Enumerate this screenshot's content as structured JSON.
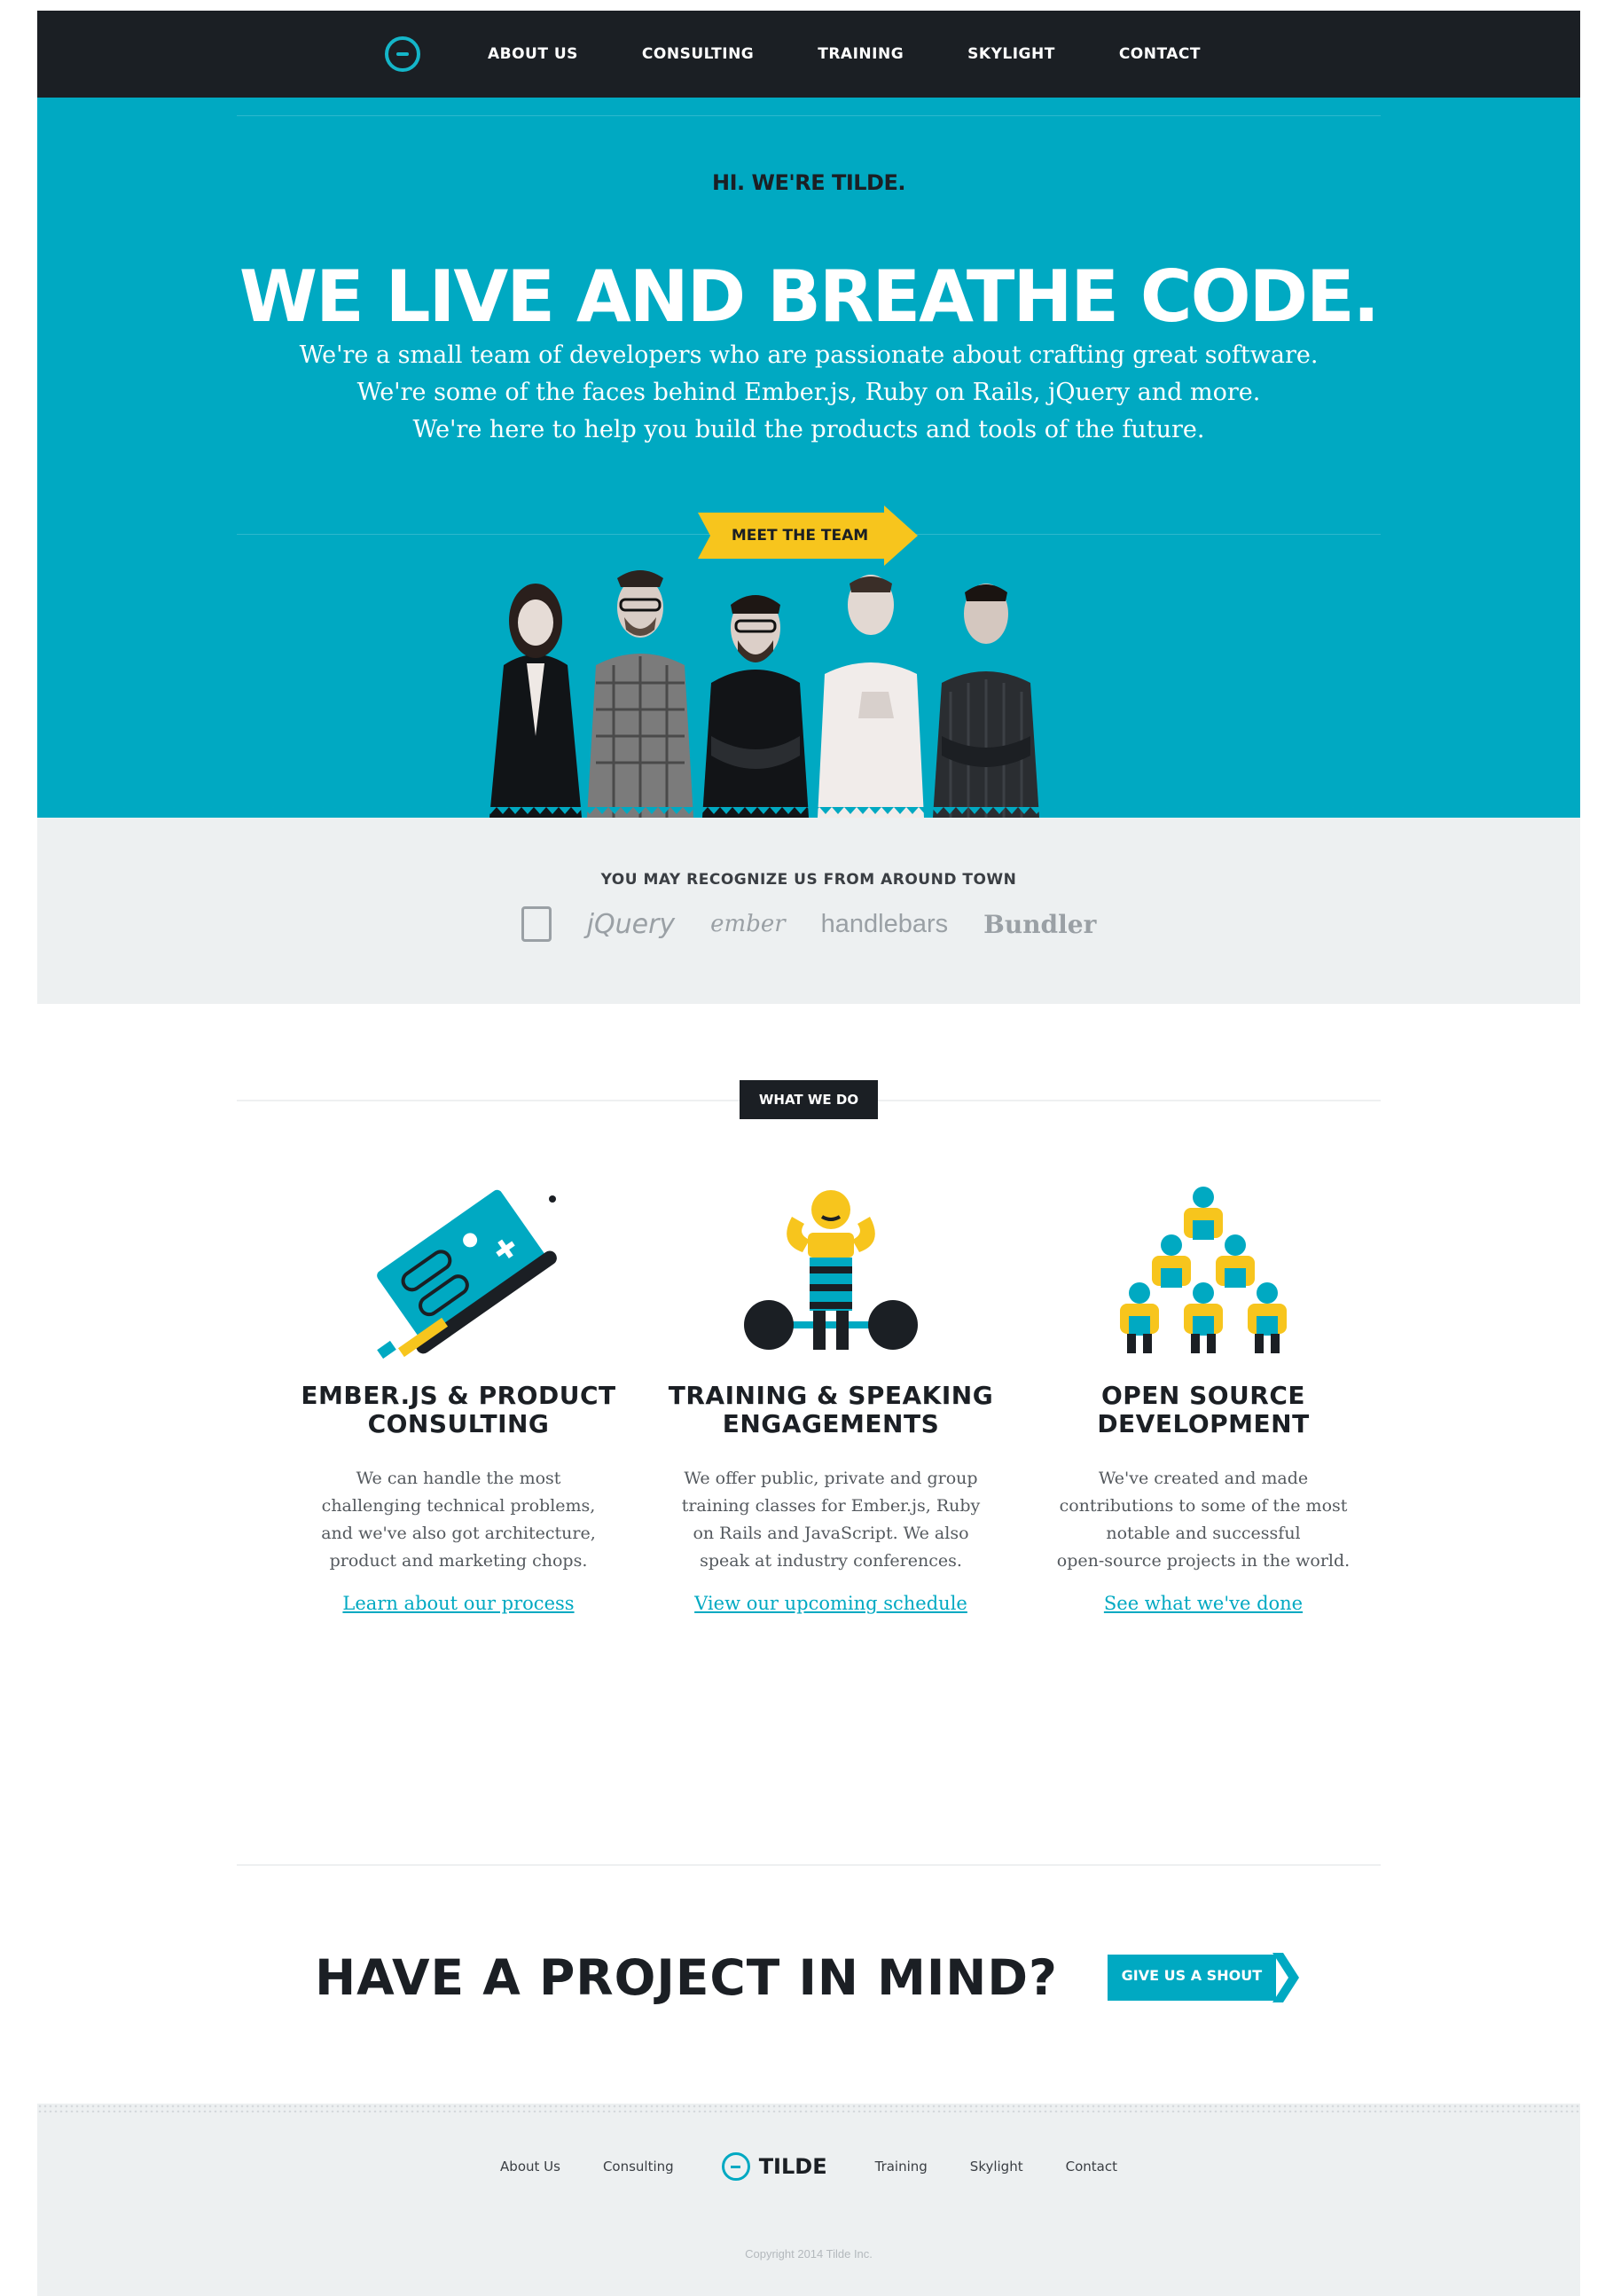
{
  "nav": {
    "items": [
      "ABOUT US",
      "CONSULTING",
      "TRAINING",
      "SKYLIGHT",
      "CONTACT"
    ]
  },
  "hero": {
    "kicker": "HI. WE'RE TILDE.",
    "title": "WE LIVE AND BREATHE CODE.",
    "lines": [
      "We're a small team of developers who are passionate about crafting great software.",
      "We're some of the faces behind Ember.js, Ruby on Rails, jQuery and more.",
      "We're here to help you build the products and tools of the future."
    ],
    "button": "MEET THE TEAM"
  },
  "recognize": {
    "title": "YOU MAY RECOGNIZE US FROM AROUND TOWN",
    "logos": [
      "jQuery",
      "ember",
      "handlebars",
      "Bundler"
    ]
  },
  "what_we_do": {
    "badge": "WHAT WE DO",
    "cards": [
      {
        "title_1": "EMBER.JS & PRODUCT",
        "title_2": "CONSULTING",
        "text": [
          "We can handle the most",
          "challenging technical problems,",
          "and we've also got architecture,",
          "product and marketing chops."
        ],
        "link": "Learn about our process"
      },
      {
        "title_1": "TRAINING & SPEAKING",
        "title_2": "ENGAGEMENTS",
        "text": [
          "We offer public, private and group",
          "training classes for Ember.js, Ruby",
          "on Rails and JavaScript. We also",
          "speak at industry conferences."
        ],
        "link": "View our upcoming schedule"
      },
      {
        "title_1": "OPEN SOURCE",
        "title_2": "DEVELOPMENT",
        "text": [
          "We've created and made",
          "contributions to some of the most",
          "notable and successful",
          "open-source projects in the world."
        ],
        "link": "See what we've done"
      }
    ]
  },
  "cta": {
    "title": "HAVE A PROJECT IN MIND?",
    "button": "GIVE US A SHOUT"
  },
  "footer": {
    "links_left": [
      "About Us",
      "Consulting"
    ],
    "brand": "TILDE",
    "links_right": [
      "Training",
      "Skylight",
      "Contact"
    ],
    "copyright": "Copyright 2014 Tilde Inc."
  },
  "colors": {
    "teal": "#00a9c2",
    "dark": "#1b1f24",
    "yellow": "#f7c51d",
    "light_gray": "#edf0f1"
  }
}
